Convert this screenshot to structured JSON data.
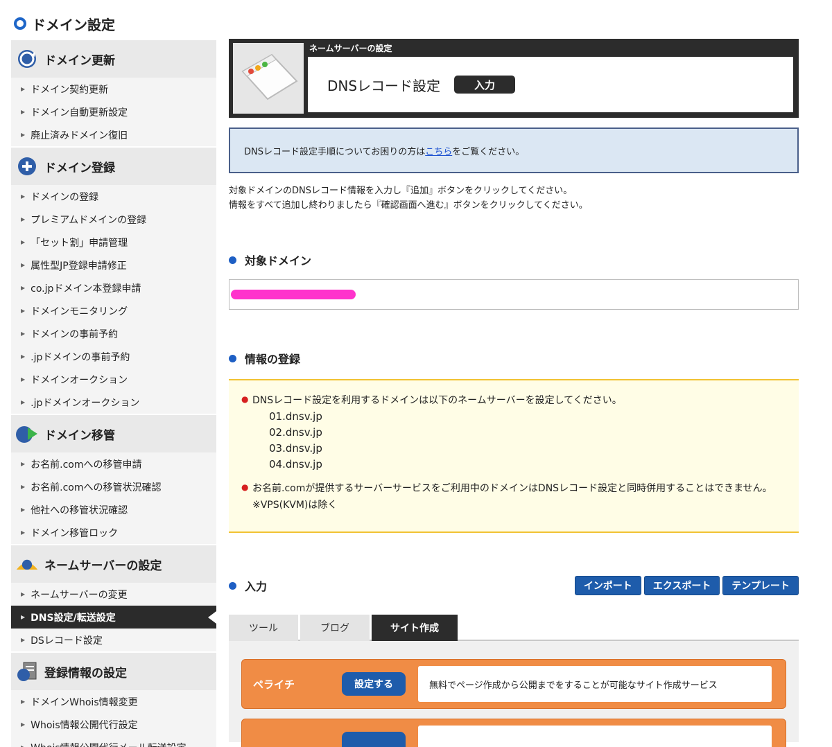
{
  "page": {
    "title": "ドメイン設定"
  },
  "sidebar": {
    "sections": [
      {
        "title": "ドメイン更新",
        "icon": "refresh-globe-icon",
        "items": [
          "ドメイン契約更新",
          "ドメイン自動更新設定",
          "廃止済みドメイン復旧"
        ]
      },
      {
        "title": "ドメイン登録",
        "icon": "plus-circle-icon",
        "items": [
          "ドメインの登録",
          "プレミアムドメインの登録",
          "「セット割」申請管理",
          "属性型JP登録申請修正",
          "co.jpドメイン本登録申請",
          "ドメインモニタリング",
          "ドメインの事前予約",
          ".jpドメインの事前予約",
          "ドメインオークション",
          ".jpドメインオークション"
        ]
      },
      {
        "title": "ドメイン移管",
        "icon": "transfer-globe-icon",
        "items": [
          "お名前.comへの移管申請",
          "お名前.comへの移管状況確認",
          "他社への移管状況確認",
          "ドメイン移管ロック"
        ]
      },
      {
        "title": "ネームサーバーの設定",
        "icon": "nameserver-icon",
        "items": [
          "ネームサーバーの変更",
          "DNS設定/転送設定",
          "DSレコード設定"
        ],
        "active_index": 1
      },
      {
        "title": "登録情報の設定",
        "icon": "document-globe-icon",
        "items": [
          "ドメインWhois情報変更",
          "Whois情報公開代行設定",
          "Whois情報公開代行メール転送設定"
        ]
      }
    ]
  },
  "hero": {
    "category": "ネームサーバーの設定",
    "title": "DNSレコード設定",
    "badge": "入力"
  },
  "notice": {
    "prefix": "DNSレコード設定手順についてお困りの方は",
    "link": "こちら",
    "suffix": "をご覧ください。"
  },
  "desc": {
    "line1": "対象ドメインのDNSレコード情報を入力し『追加』ボタンをクリックしてください。",
    "line2": "情報をすべて追加し終わりましたら『確認画面へ進む』ボタンをクリックしてください。"
  },
  "target": {
    "heading": "対象ドメイン"
  },
  "info": {
    "heading": "情報の登録",
    "bullet1": "DNSレコード設定を利用するドメインは以下のネームサーバーを設定してください。",
    "nameservers": [
      "01.dnsv.jp",
      "02.dnsv.jp",
      "03.dnsv.jp",
      "04.dnsv.jp"
    ],
    "bullet2": "お名前.comが提供するサーバーサービスをご利用中のドメインはDNSレコード設定と同時併用することはできません。",
    "bullet2_note": "※VPS(KVM)は除く"
  },
  "input": {
    "heading": "入力",
    "buttons": {
      "import": "インポート",
      "export": "エクスポート",
      "template": "テンプレート"
    },
    "tabs": [
      "ツール",
      "ブログ",
      "サイト作成"
    ],
    "active_tab": 2
  },
  "cards": [
    {
      "name": "ペライチ",
      "button": "設定する",
      "desc": "無料でページ作成から公開までをすることが可能なサイト作成サービス"
    }
  ],
  "colors": {
    "accent_blue": "#1e5cab",
    "orange": "#f08c45",
    "dark": "#2c2c2c"
  }
}
